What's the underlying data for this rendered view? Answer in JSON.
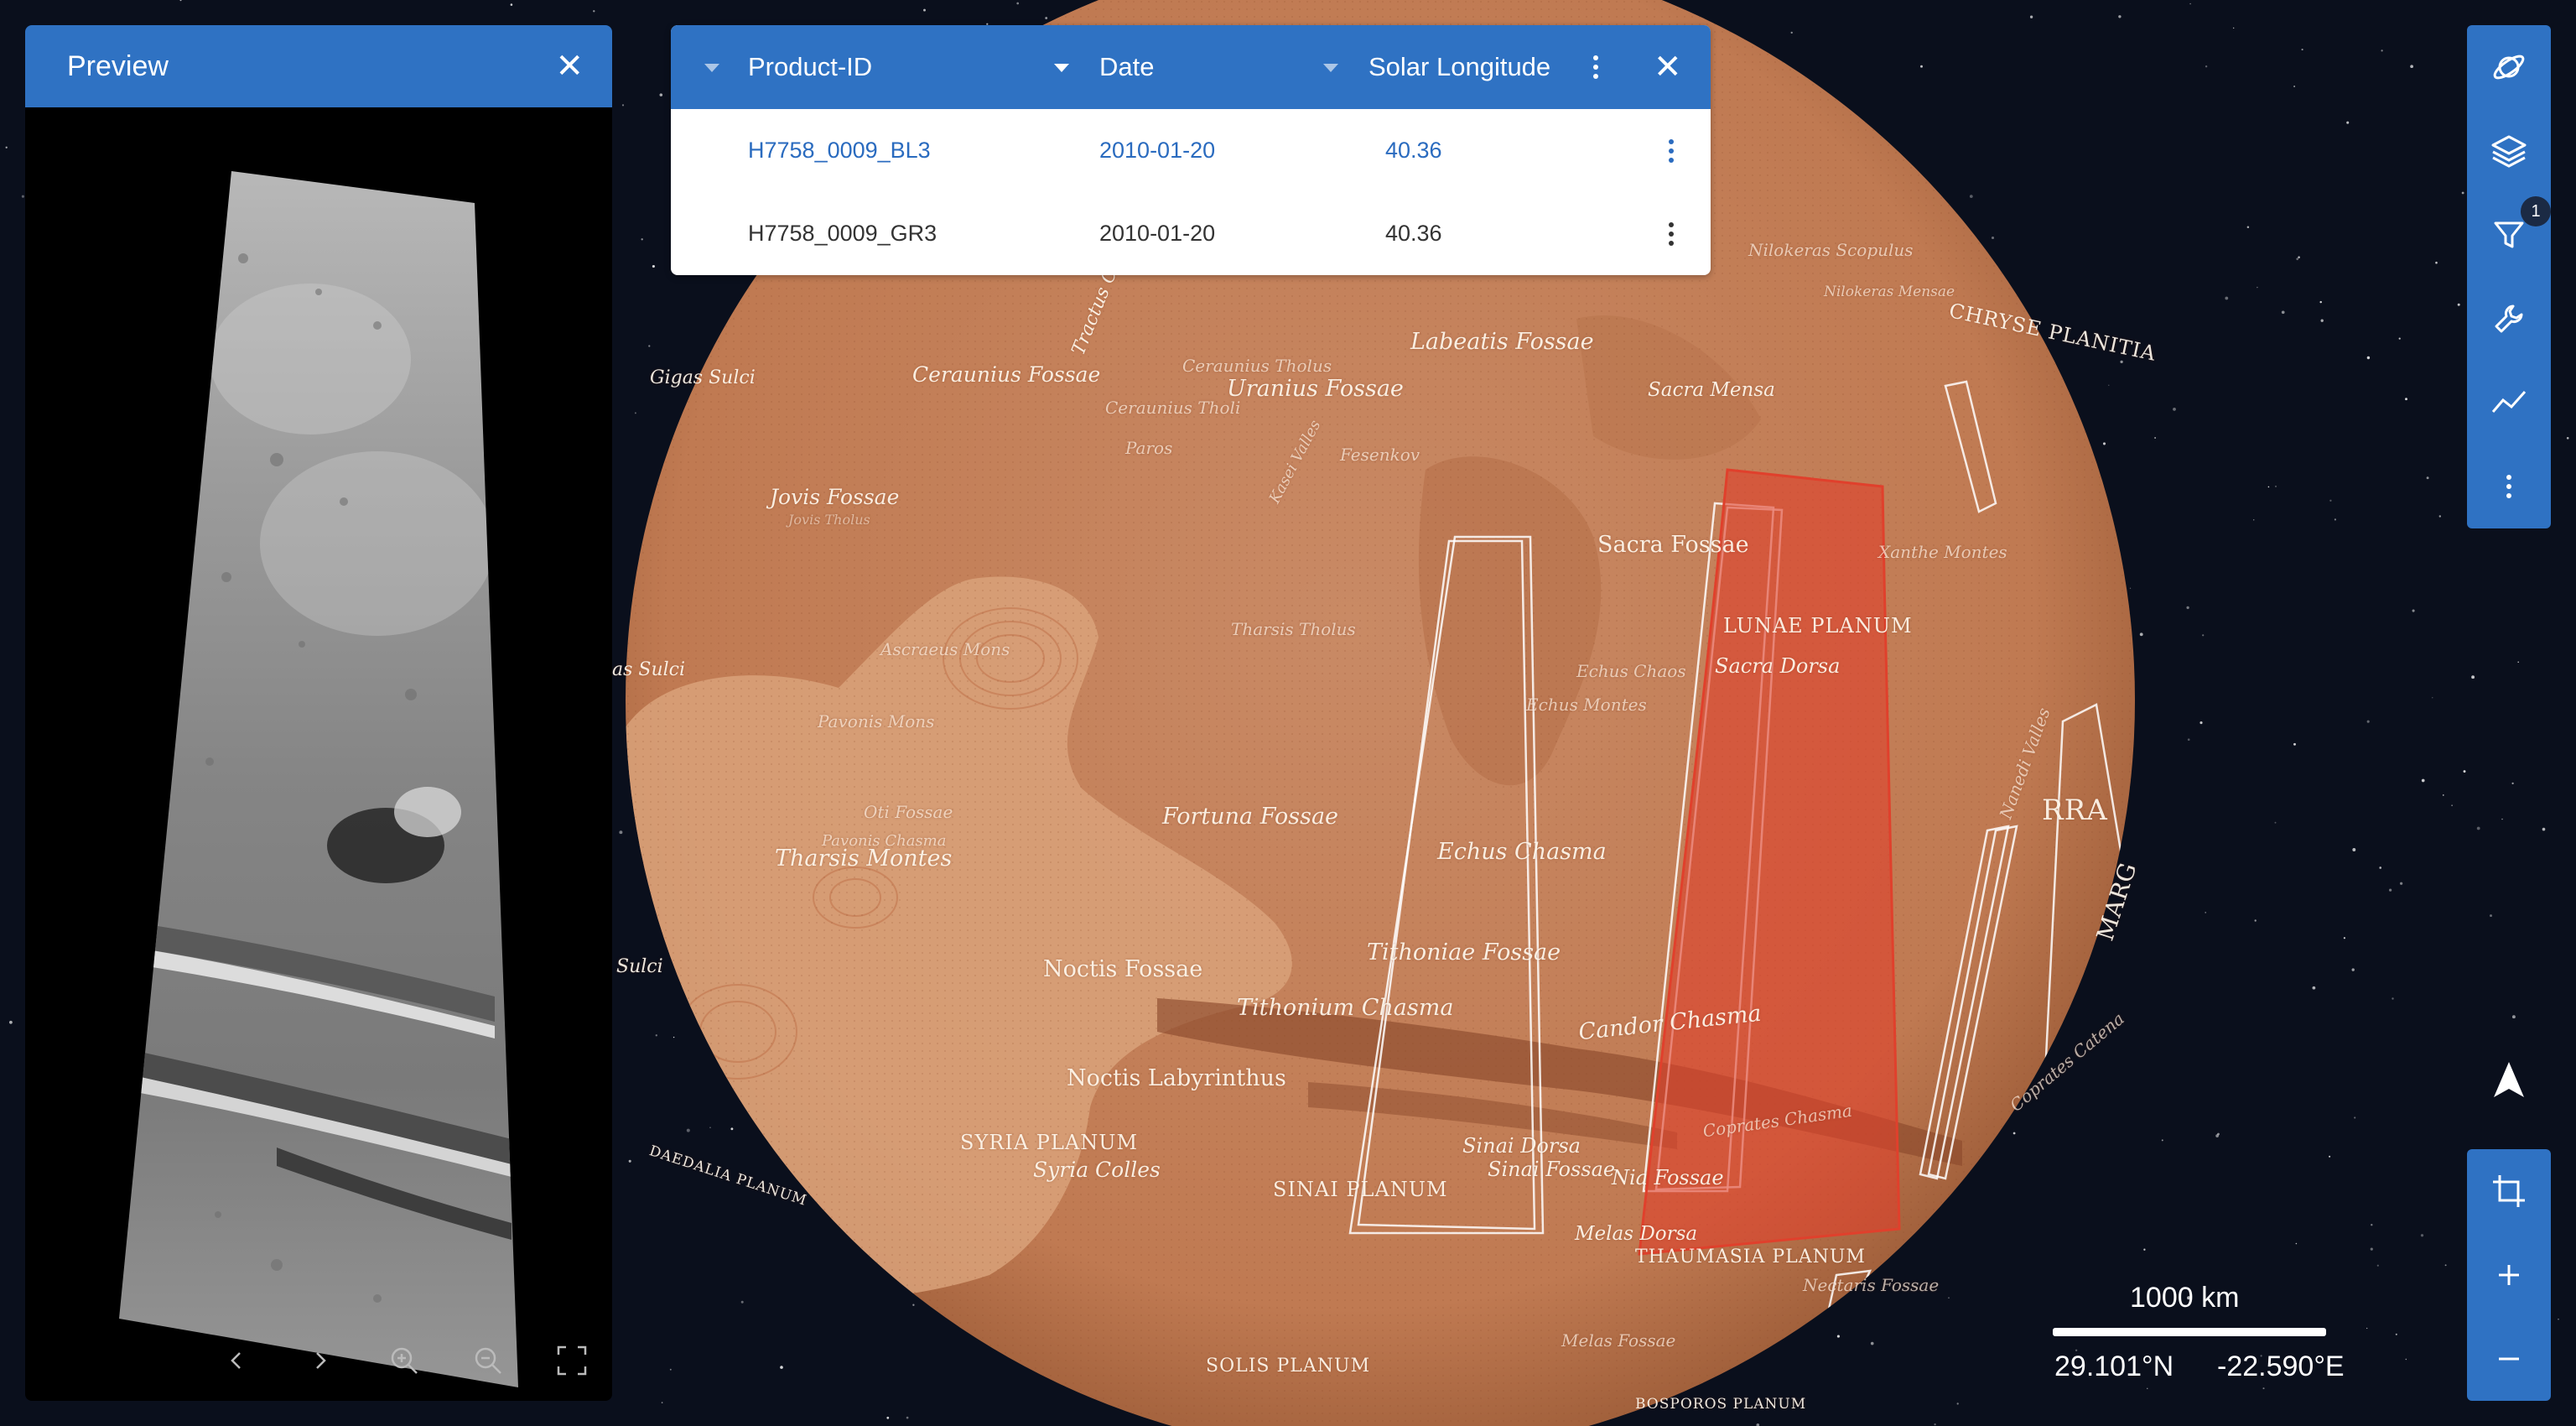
{
  "preview": {
    "title": "Preview"
  },
  "product_table": {
    "columns": [
      {
        "label": "Product-ID"
      },
      {
        "label": "Date"
      },
      {
        "label": "Solar Longitude"
      }
    ],
    "rows": [
      {
        "product_id": "H7758_0009_BL3",
        "date": "2010-01-20",
        "solar_longitude": "40.36",
        "selected": true
      },
      {
        "product_id": "H7758_0009_GR3",
        "date": "2010-01-20",
        "solar_longitude": "40.36",
        "selected": false
      }
    ]
  },
  "toolbar": {
    "items": [
      "planet-icon",
      "layers-icon",
      "filter-icon",
      "tools-icon",
      "chart-icon",
      "more-icon"
    ],
    "filter_badge": "1"
  },
  "zoom_toolbar": {
    "items": [
      "crop-icon",
      "zoom-in-icon",
      "zoom-out-icon"
    ]
  },
  "scale": {
    "label": "1000 km"
  },
  "coordinates": {
    "lat": "29.101°N",
    "lon": "-22.590°E"
  },
  "colors": {
    "accent": "#2f72c3",
    "link": "#2a6bbf",
    "mars": "#c7825b",
    "highlight": "#e0402c"
  },
  "map_labels": {
    "tractus": "Tractus C...",
    "labeatis_fossae": "Labeatis Fossae",
    "nilokeras_scopulus": "Nilokeras Scopulus",
    "nilokeras_mensae": "Nilokeras Mensae",
    "ceraunius_fossae": "Ceraunius Fossae",
    "uranius_fossae": "Uranius Fossae",
    "sacra_mensa": "Sacra Mensa",
    "chryse_planitia": "CHRYSE PLANITIA",
    "ceraunius_tholus": "Ceraunius Tholus",
    "ceraunius_tholi": "Ceraunius Tholi",
    "paros": "Paros",
    "tharsis_tholus": "Tharsis Tholus",
    "fesenkov": "Fesenkov",
    "jovis_fossae": "Jovis Fossae",
    "jovis_tholus": "Jovis Tholus",
    "kasei_valles": "Kasei Valles",
    "sacra_fossae": "Sacra Fossae",
    "xanthe_montes": "Xanthe Montes",
    "lunae_planum": "LUNAE PLANUM",
    "sacra_dorsa": "Sacra Dorsa",
    "echus_chaos": "Echus Chaos",
    "echus_montes": "Echus Montes",
    "fortuna_fossae": "Fortuna Fossae",
    "tharsis_montes": "Tharsis Montes",
    "pavonis_chasma": "Pavonis Chasma",
    "echus_chasma": "Echus Chasma",
    "noctis_fossae": "Noctis Fossae",
    "tithoniae_fossae": "Tithoniae Fossae",
    "tithonium_chasma": "Tithonium Chasma",
    "candor_chasma": "Candor Chasma",
    "coprates_chasma": "Coprates Chasma",
    "noctis_labyrinthus": "Noctis Labyrinthus",
    "syria_planum": "SYRIA PLANUM",
    "syria_colles": "Syria Colles",
    "sinai_planum": "SINAI PLANUM",
    "sinai_dorsa": "Sinai Dorsa",
    "sinai_fossae": "Sinai Fossae",
    "nia_fossae": "Nia Fossae",
    "melas_dorsa": "Melas Dorsa",
    "thaumasia_planum": "THAUMASIA PLANUM",
    "melas_fossae": "Melas Fossae",
    "solis_planum": "SOLIS PLANUM",
    "daedalia_planum": "DAEDALIA PLANUM",
    "gigas_sulci": "Gigas Sulci",
    "arsia_sulci": "as Sulci",
    "ulysses_sulci": "Sulci",
    "oti_fossae": "Oti Fossae",
    "ascraeus_mons": "Ascraeus Mons",
    "pavonis_mons": "Pavonis Mons",
    "arra": "RRA",
    "nanedi_valles": "Nanedi Valles",
    "margaritifer": "MARG",
    "coprates_catena": "Coprates Catena",
    "necessitas_fossae": "Nectaris Fossae",
    "bosporos": "BOSPOROS PLANUM"
  }
}
